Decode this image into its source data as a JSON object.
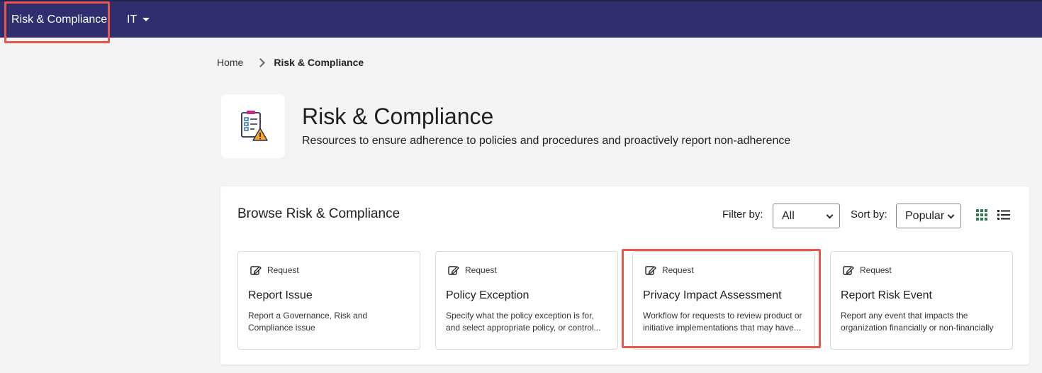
{
  "nav": {
    "items": [
      {
        "label": "Risk & Compliance"
      },
      {
        "label": "IT"
      }
    ]
  },
  "breadcrumb": {
    "home": "Home",
    "current": "Risk & Compliance"
  },
  "header": {
    "icon": "checklist-warning-icon",
    "title": "Risk & Compliance",
    "subtitle": "Resources to ensure adherence to policies and procedures and proactively report non-adherence"
  },
  "browse": {
    "title": "Browse Risk & Compliance",
    "filter_label": "Filter by:",
    "filter_value": "All",
    "sort_label": "Sort by:",
    "sort_value": "Popular"
  },
  "cards": [
    {
      "type": "Request",
      "title": "Report Issue",
      "description": "Report a Governance, Risk and Compliance issue"
    },
    {
      "type": "Request",
      "title": "Policy Exception",
      "description": "Specify what the policy exception is for, and select appropriate policy, or control..."
    },
    {
      "type": "Request",
      "title": "Privacy Impact Assessment",
      "description": "Workflow for requests to review product or initiative implementations that may have..."
    },
    {
      "type": "Request",
      "title": "Report Risk Event",
      "description": "Report any event that impacts the organization financially or non-financially"
    }
  ],
  "colors": {
    "nav_bg": "#2f2f6f",
    "highlight": "#e8584a",
    "grid_icon_active": "#2e7d4f"
  }
}
